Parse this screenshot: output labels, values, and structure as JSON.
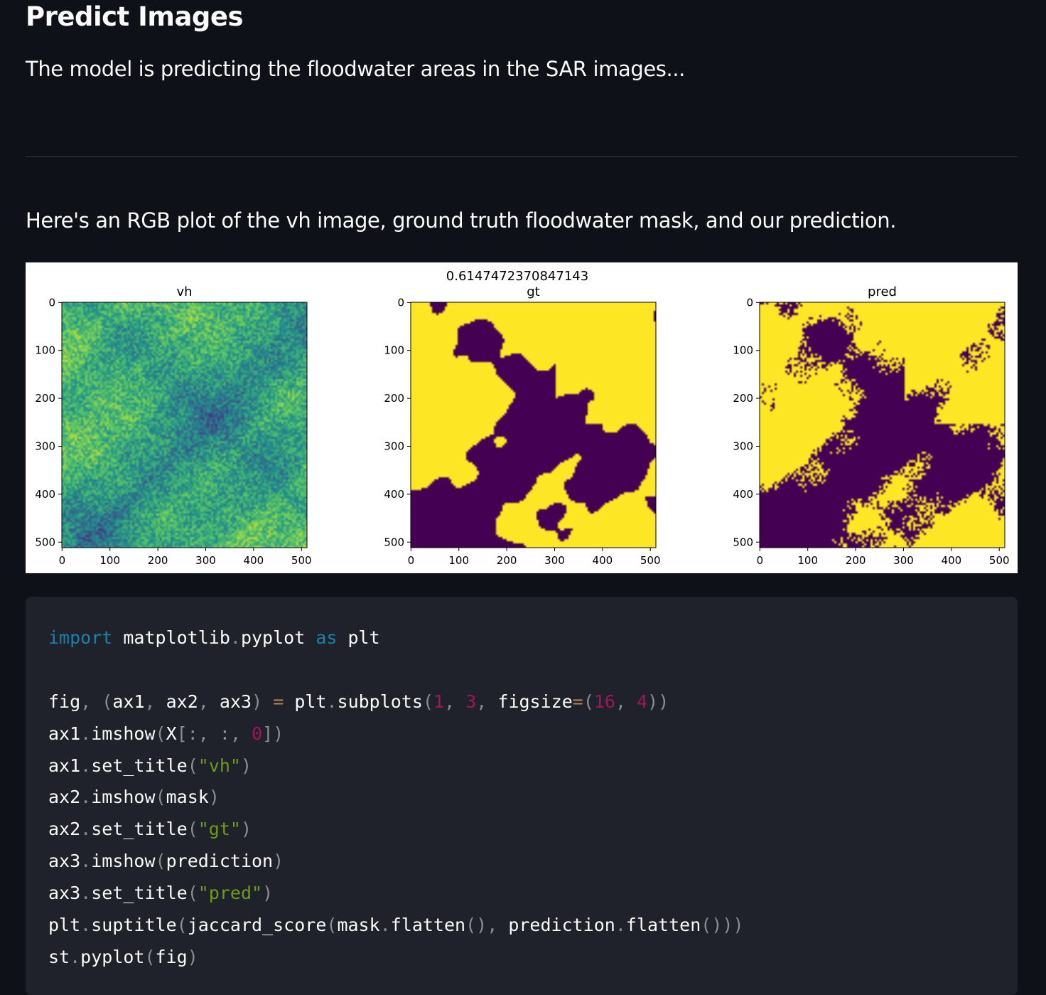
{
  "header": {
    "title": "Predict Images",
    "subtitle": "The model is predicting the floodwater areas in the SAR images..."
  },
  "section": {
    "description": "Here's an RGB plot of the vh image, ground truth floodwater mask, and our prediction."
  },
  "chart_data": {
    "type": "heatmap",
    "suptitle": "0.6147472370847143",
    "colormap": "viridis",
    "colors": {
      "low": "#440154",
      "high": "#fde725"
    },
    "panels": [
      {
        "title": "vh",
        "content": "SAR vh backscatter image (continuous)",
        "xticks": [
          "0",
          "100",
          "200",
          "300",
          "400",
          "500"
        ],
        "yticks": [
          "0",
          "100",
          "200",
          "300",
          "400",
          "500"
        ],
        "xlim": [
          0,
          512
        ],
        "ylim": [
          512,
          0
        ]
      },
      {
        "title": "gt",
        "content": "binary ground-truth floodwater mask",
        "xticks": [
          "0",
          "100",
          "200",
          "300",
          "400",
          "500"
        ],
        "yticks": [
          "0",
          "100",
          "200",
          "300",
          "400",
          "500"
        ],
        "xlim": [
          0,
          512
        ],
        "ylim": [
          512,
          0
        ]
      },
      {
        "title": "pred",
        "content": "binary predicted floodwater mask",
        "xticks": [
          "0",
          "100",
          "200",
          "300",
          "400",
          "500"
        ],
        "yticks": [
          "0",
          "100",
          "200",
          "300",
          "400",
          "500"
        ],
        "xlim": [
          0,
          512
        ],
        "ylim": [
          512,
          0
        ]
      }
    ]
  },
  "code": {
    "lines": [
      "import matplotlib.pyplot as plt",
      "",
      "fig, (ax1, ax2, ax3) = plt.subplots(1, 3, figsize=(16, 4))",
      "ax1.imshow(X[:, :, 0])",
      "ax1.set_title(\"vh\")",
      "ax2.imshow(mask)",
      "ax2.set_title(\"gt\")",
      "ax3.imshow(prediction)",
      "ax3.set_title(\"pred\")",
      "plt.suptitle(jaccard_score(mask.flatten(), prediction.flatten()))",
      "st.pyplot(fig)"
    ]
  }
}
